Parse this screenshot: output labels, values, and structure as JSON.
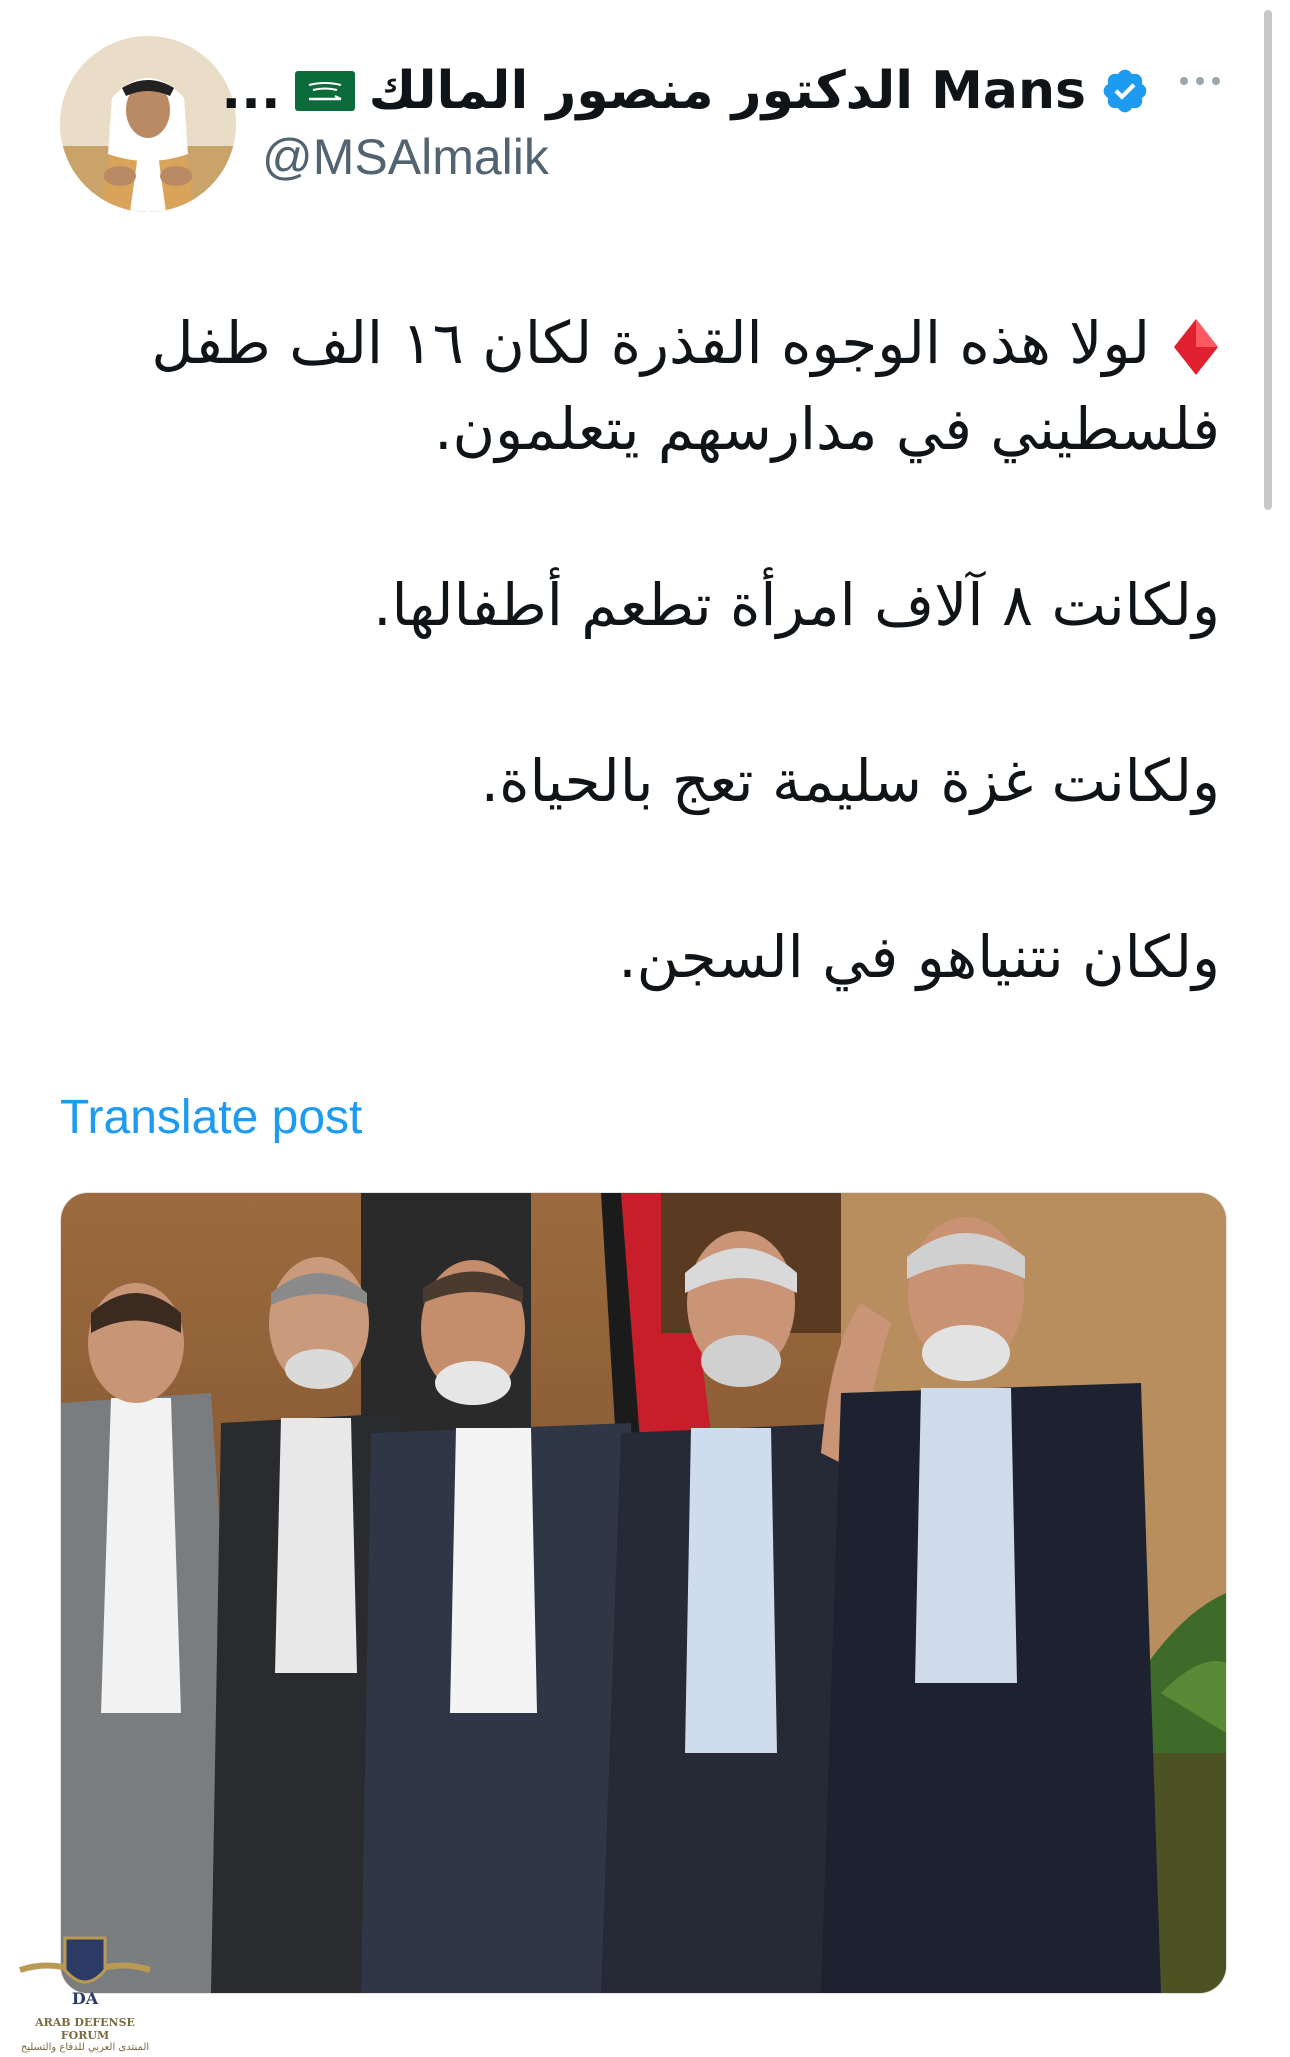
{
  "author": {
    "display_name_prefix": "...",
    "display_name": "الدكتور منصور المالك Mans",
    "handle": "@MSAlmalik",
    "avatar_icon": "profile-photo-man-in-ghutra",
    "flag_icon": "saudi-flag",
    "verified_icon": "verified-badge",
    "verified_color": "#1d9bf0"
  },
  "menu": {
    "more_icon": "more-dots-icon"
  },
  "tweet": {
    "leading_emoji": "red-diamond",
    "paragraphs": [
      "لولا هذه الوجوه القذرة لكان ١٦ الف طفل فلسطيني في مدارسهم يتعلمون.",
      "ولكانت ٨ آلاف امرأة تطعم أطفالها.",
      "ولكانت غزة سليمة تعج بالحياة.",
      "ولكان نتنياهو في السجن."
    ]
  },
  "translate": {
    "label": "Translate post",
    "color": "#1d9bf0"
  },
  "media": {
    "type": "photo",
    "description_icon": "group-photo-five-men-in-suits"
  },
  "watermark": {
    "logo_icon": "shield-wings-logo",
    "abbrev": "DA",
    "name_en": "ARAB DEFENSE FORUM",
    "name_ar": "المنتدى العربي للدفاع والتسليح"
  }
}
